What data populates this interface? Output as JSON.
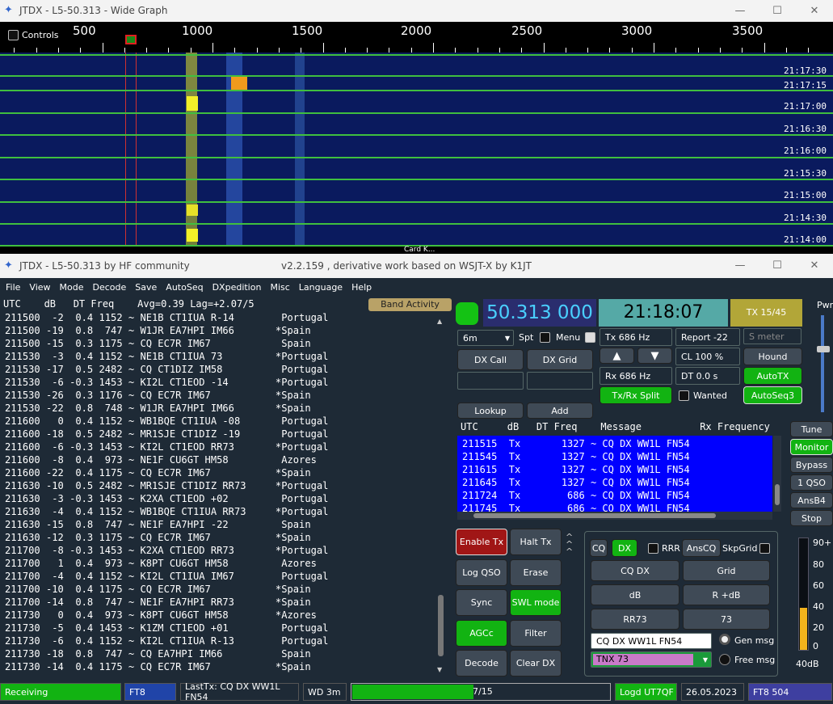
{
  "wide_graph": {
    "title": "JTDX - L5-50.313 - Wide Graph",
    "controls_label": "Controls",
    "scale_labels": [
      "500",
      "1000",
      "1500",
      "2000",
      "2500",
      "3000",
      "3500"
    ],
    "timestamps": [
      "21:17:30",
      "21:17:15",
      "21:17:00",
      "21:16:30",
      "21:16:00",
      "21:15:30",
      "21:15:00",
      "21:14:30",
      "21:14:00"
    ],
    "card_label": "Card K..."
  },
  "main_window": {
    "title": "JTDX - L5-50.313  by HF community",
    "subtitle": "v2.2.159 , derivative work based on WSJT-X by K1JT"
  },
  "menu": [
    "File",
    "View",
    "Mode",
    "Decode",
    "Save",
    "AutoSeq",
    "DXpedition",
    "Misc",
    "Language",
    "Help"
  ],
  "band_activity": {
    "header": "UTC    dB   DT Freq    Avg=0.39 Lag=+2.07/5",
    "button": "Band Activity",
    "rows": [
      "211500  -2  0.4 1152 ~ NE1B CT1IUA R-14        Portugal",
      "211500 -19  0.8  747 ~ W1JR EA7HPI IM66       *Spain",
      "211500 -15  0.3 1175 ~ CQ EC7R IM67            Spain",
      "211530  -3  0.4 1152 ~ NE1B CT1IUA 73         *Portugal",
      "211530 -17  0.5 2482 ~ CQ CT1DIZ IM58          Portugal",
      "211530  -6 -0.3 1453 ~ KI2L CT1EOD -14        *Portugal",
      "211530 -26  0.3 1176 ~ CQ EC7R IM67           *Spain",
      "211530 -22  0.8  748 ~ W1JR EA7HPI IM66       *Spain",
      "211600   0  0.4 1152 ~ WB1BQE CT1IUA -08       Portugal",
      "211600 -18  0.5 2482 ~ MR1SJE CT1DIZ -19       Portugal",
      "211600  -6 -0.3 1453 ~ KI2L CT1EOD RR73       *Portugal",
      "211600  -8  0.4  973 ~ NE1F CU6GT HM58         Azores",
      "211600 -22  0.4 1175 ~ CQ EC7R IM67           *Spain",
      "211630 -10  0.5 2482 ~ MR1SJE CT1DIZ RR73     *Portugal",
      "211630  -3 -0.3 1453 ~ K2XA CT1EOD +02         Portugal",
      "211630  -4  0.4 1152 ~ WB1BQE CT1IUA RR73     *Portugal",
      "211630 -15  0.8  747 ~ NE1F EA7HPI -22         Spain",
      "211630 -12  0.3 1175 ~ CQ EC7R IM67           *Spain",
      "211700  -8 -0.3 1453 ~ K2XA CT1EOD RR73       *Portugal",
      "211700   1  0.4  973 ~ K8PT CU6GT HM58         Azores",
      "211700  -4  0.4 1152 ~ KI2L CT1IUA IM67        Portugal",
      "211700 -10  0.4 1175 ~ CQ EC7R IM67           *Spain",
      "211700 -14  0.8  747 ~ NE1F EA7HPI RR73       *Spain",
      "211730   0  0.4  973 ~ K8PT CU6GT HM58        *Azores",
      "211730  -5  0.4 1453 ~ K1ZM CT1EOD +01         Portugal",
      "211730  -6  0.4 1152 ~ KI2L CT1IUA R-13        Portugal",
      "211730 -18  0.8  747 ~ CQ EA7HPI IM66          Spain",
      "211730 -14  0.4 1175 ~ CQ EC7R IM67           *Spain"
    ]
  },
  "display": {
    "frequency": "50.313 000",
    "clock": "21:18:07",
    "tx_period": "TX 15/45"
  },
  "controls": {
    "band": "6m",
    "spt": "Spt",
    "menu": "Menu",
    "tx_hz": "Tx  686  Hz",
    "report": "Report -22",
    "smeter_placeholder": "S meter",
    "dx_call": "DX Call",
    "dx_grid": "DX Grid",
    "cl": "CL  100 %",
    "hound": "Hound",
    "rx_hz": "Rx  686  Hz",
    "dt": "DT 0.0 s",
    "autotx": "AutoTX",
    "txrx_split": "Tx/Rx Split",
    "wanted": "Wanted",
    "autoseq3": "AutoSeq3",
    "lookup": "Lookup",
    "add": "Add",
    "up_arrow": "▲",
    "down_arrow": "▼"
  },
  "rx_frequency": {
    "header": "UTC     dB   DT Freq    Message          Rx Frequency",
    "rows": [
      "211515  Tx       1327 ~ CQ DX WW1L FN54",
      "211545  Tx       1327 ~ CQ DX WW1L FN54",
      "211615  Tx       1327 ~ CQ DX WW1L FN54",
      "211645  Tx       1327 ~ CQ DX WW1L FN54",
      "211724  Tx        686 ~ CQ DX WW1L FN54",
      "211745  Tx        686 ~ CQ DX WW1L FN54"
    ]
  },
  "right_buttons": [
    "Tune",
    "Monitor",
    "Bypass",
    "1 QSO",
    "AnsB4",
    "Stop"
  ],
  "pwr_label": "Pwr",
  "action_buttons": {
    "enable_tx": "Enable Tx",
    "halt_tx": "Halt Tx",
    "log_qso": "Log QSO",
    "erase": "Erase",
    "sync": "Sync",
    "swl_mode": "SWL mode",
    "agcc": "AGCc",
    "filter": "Filter",
    "decode": "Decode",
    "clear_dx": "Clear DX"
  },
  "messages": {
    "cq": "CQ",
    "dx": "DX",
    "rrr": "RRR",
    "anscq": "AnsCQ",
    "skpgrid": "SkpGrid",
    "cq_dx": "CQ DX",
    "grid": "Grid",
    "db": "dB",
    "r_db": "R +dB",
    "rr73": "RR73",
    "m73": "73",
    "gen_msg_text": "CQ DX WW1L FN54",
    "gen_msg": "Gen msg",
    "free_msg_text": "TNX 73",
    "free_msg": "Free msg"
  },
  "meter": {
    "labels": [
      "90+",
      "80",
      "60",
      "40",
      "20",
      "0"
    ],
    "db": "40dB",
    "level": 0.38
  },
  "status": {
    "receiving": "Receiving",
    "mode": "FT8",
    "last_tx": "LastTx: CQ DX WW1L FN54",
    "wd": "WD 3m",
    "progress": "7/15",
    "progress_value": 0.47,
    "logd": "Logd UT7QF",
    "date": "26.05.2023",
    "ft8_count": "FT8  504"
  },
  "colors": {
    "accent_green": "#12b312",
    "rx_blue": "#0000ff",
    "freq_bg": "#2a2d6e",
    "clock_bg": "#55a9a6",
    "tx_bg": "#b2a638",
    "enable_tx": "#a01616"
  }
}
